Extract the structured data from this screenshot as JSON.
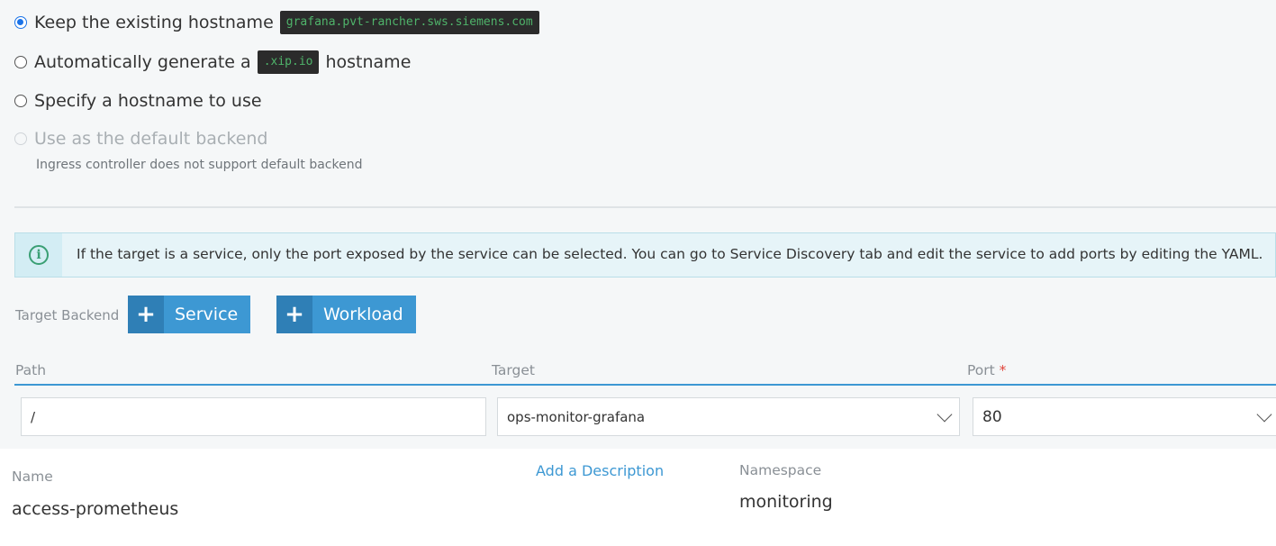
{
  "hostname_options": {
    "keep_existing": {
      "label": "Keep the existing hostname",
      "hostname": "grafana.pvt-rancher.sws.siemens.com",
      "selected": true
    },
    "auto_generate": {
      "label_before": "Automatically generate a",
      "code": ".xip.io",
      "label_after": "hostname"
    },
    "specify": {
      "label": "Specify a hostname to use"
    },
    "default_backend": {
      "label": "Use as the default backend",
      "hint": "Ingress controller does not support default backend",
      "disabled": true
    }
  },
  "info_banner": {
    "icon": "info-circle-icon",
    "text": "If the target is a service, only the port exposed by the service can be selected. You can go to Service Discovery tab and edit the service to add ports by editing the YAML."
  },
  "target_backend": {
    "label": "Target Backend",
    "service_button": "Service",
    "workload_button": "Workload"
  },
  "rule_table": {
    "columns": {
      "path": "Path",
      "target": "Target",
      "port": "Port",
      "port_required": "*"
    },
    "row": {
      "path": "/",
      "target": "ops-monitor-grafana",
      "port": "80"
    }
  },
  "details": {
    "name_label": "Name",
    "name_value": "access-prometheus",
    "description_link": "Add a Description",
    "namespace_label": "Namespace",
    "namespace_value": "monitoring"
  },
  "colors": {
    "accent": "#3d98d3",
    "code_bg": "#2b2b2b",
    "code_text": "#4fb36a",
    "info_bg": "#e6f4f8",
    "required": "#e0453b"
  }
}
